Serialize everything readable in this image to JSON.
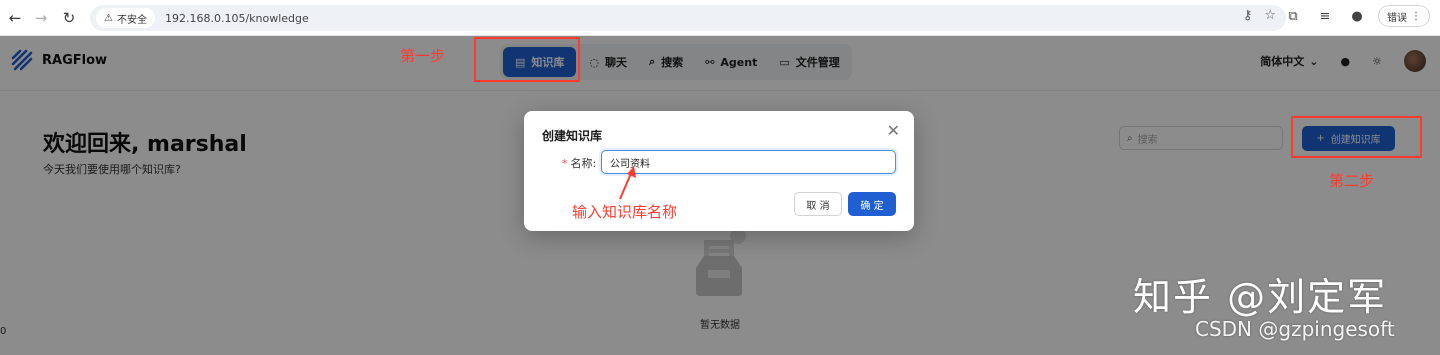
{
  "browser": {
    "insecure_label": "不安全",
    "url": "192.168.0.105/knowledge",
    "profile_chip": "错误"
  },
  "app": {
    "brand": "RAGFlow",
    "tabs": [
      {
        "label": "知识库",
        "icon": "database-icon",
        "active": true
      },
      {
        "label": "聊天",
        "icon": "chat-icon"
      },
      {
        "label": "搜索",
        "icon": "search-icon"
      },
      {
        "label": "Agent",
        "icon": "agent-icon"
      },
      {
        "label": "文件管理",
        "icon": "folder-icon"
      }
    ],
    "language": "简体中文",
    "welcome_title": "欢迎回来, marshal",
    "welcome_subtitle": "今天我们要使用哪个知识库?",
    "search_placeholder": "搜索",
    "create_label": "创建知识库",
    "empty_text": "暂无数据",
    "stray_text": "0"
  },
  "modal": {
    "title": "创建知识库",
    "name_label": "名称:",
    "name_value": "公司资料",
    "cancel_label": "取 消",
    "ok_label": "确 定"
  },
  "annotations": {
    "step1": "第一步",
    "step2": "第二步",
    "input_hint": "输入知识库名称",
    "color": "#ff3b30"
  },
  "watermarks": {
    "zhihu": "知乎 @刘定军",
    "csdn": "CSDN @gzpingesoft"
  },
  "colors": {
    "primary": "#1f5fd1",
    "annotation": "#ff3b30"
  }
}
